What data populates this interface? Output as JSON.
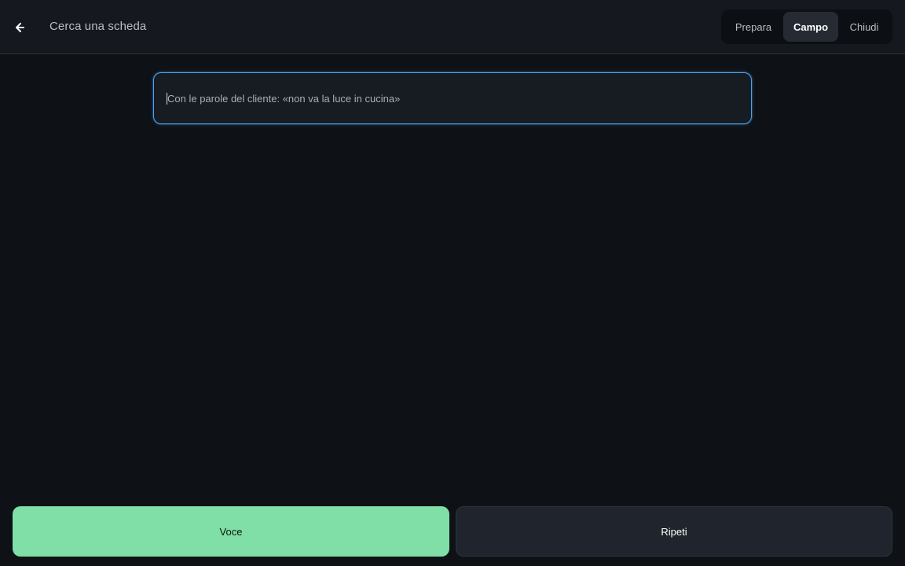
{
  "header": {
    "back_icon": "arrow-left-icon",
    "title": "Cerca una scheda"
  },
  "mode_switch": {
    "tabs": [
      {
        "label": "Prepara",
        "active": false
      },
      {
        "label": "Campo",
        "active": true
      },
      {
        "label": "Chiudi",
        "active": false
      }
    ]
  },
  "search": {
    "value": "",
    "placeholder": "Con le parole del cliente: «non va la luce in cucina»"
  },
  "actions": {
    "voice_label": "Voce",
    "repeat_label": "Ripeti"
  },
  "colors": {
    "background": "#0e1116",
    "topbar": "#15191f",
    "accent_focus": "#4aa3f0",
    "voice_button": "#7fdfa7",
    "repeat_button": "#20242c",
    "active_tab": "#262a33"
  }
}
